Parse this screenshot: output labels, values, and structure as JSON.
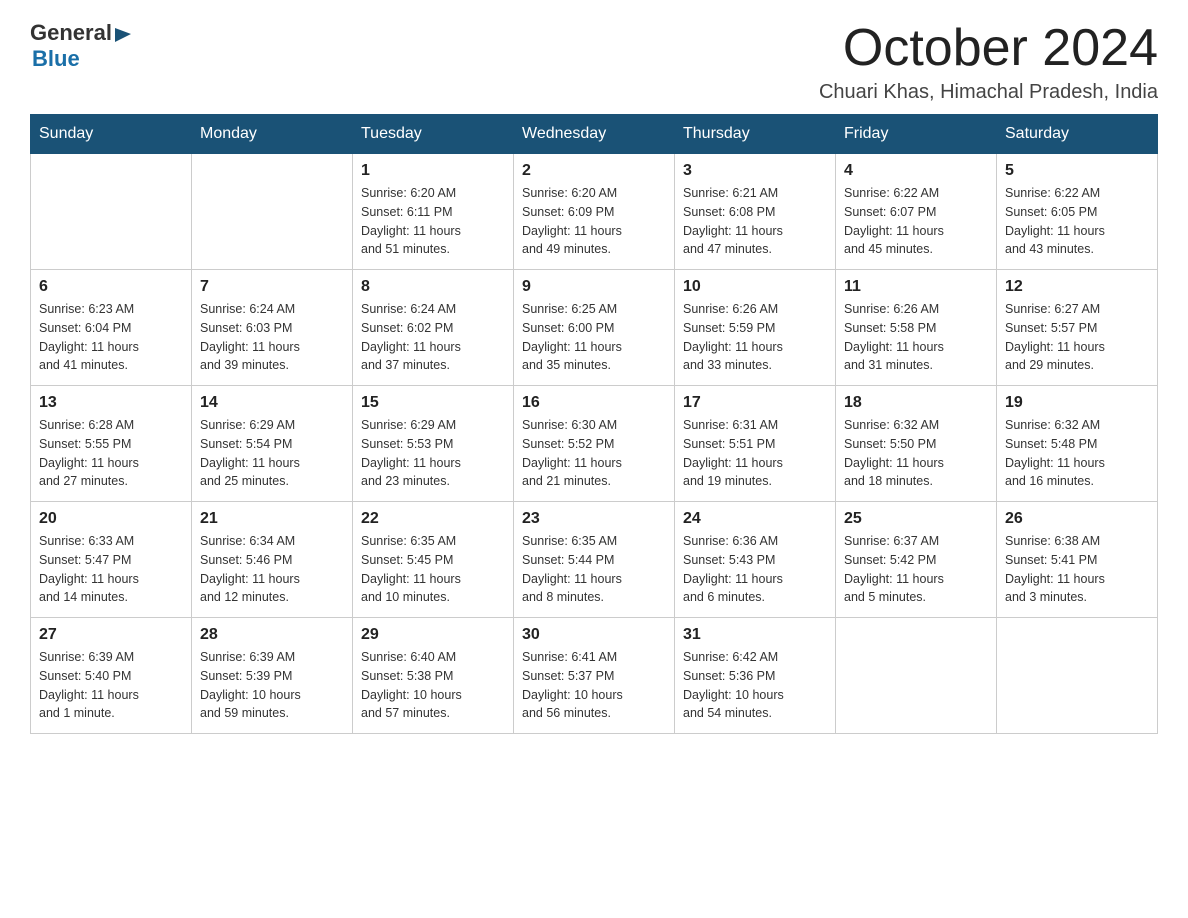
{
  "logo": {
    "general": "General",
    "blue": "Blue"
  },
  "title": "October 2024",
  "location": "Chuari Khas, Himachal Pradesh, India",
  "weekdays": [
    "Sunday",
    "Monday",
    "Tuesday",
    "Wednesday",
    "Thursday",
    "Friday",
    "Saturday"
  ],
  "weeks": [
    [
      {
        "day": "",
        "info": ""
      },
      {
        "day": "",
        "info": ""
      },
      {
        "day": "1",
        "info": "Sunrise: 6:20 AM\nSunset: 6:11 PM\nDaylight: 11 hours\nand 51 minutes."
      },
      {
        "day": "2",
        "info": "Sunrise: 6:20 AM\nSunset: 6:09 PM\nDaylight: 11 hours\nand 49 minutes."
      },
      {
        "day": "3",
        "info": "Sunrise: 6:21 AM\nSunset: 6:08 PM\nDaylight: 11 hours\nand 47 minutes."
      },
      {
        "day": "4",
        "info": "Sunrise: 6:22 AM\nSunset: 6:07 PM\nDaylight: 11 hours\nand 45 minutes."
      },
      {
        "day": "5",
        "info": "Sunrise: 6:22 AM\nSunset: 6:05 PM\nDaylight: 11 hours\nand 43 minutes."
      }
    ],
    [
      {
        "day": "6",
        "info": "Sunrise: 6:23 AM\nSunset: 6:04 PM\nDaylight: 11 hours\nand 41 minutes."
      },
      {
        "day": "7",
        "info": "Sunrise: 6:24 AM\nSunset: 6:03 PM\nDaylight: 11 hours\nand 39 minutes."
      },
      {
        "day": "8",
        "info": "Sunrise: 6:24 AM\nSunset: 6:02 PM\nDaylight: 11 hours\nand 37 minutes."
      },
      {
        "day": "9",
        "info": "Sunrise: 6:25 AM\nSunset: 6:00 PM\nDaylight: 11 hours\nand 35 minutes."
      },
      {
        "day": "10",
        "info": "Sunrise: 6:26 AM\nSunset: 5:59 PM\nDaylight: 11 hours\nand 33 minutes."
      },
      {
        "day": "11",
        "info": "Sunrise: 6:26 AM\nSunset: 5:58 PM\nDaylight: 11 hours\nand 31 minutes."
      },
      {
        "day": "12",
        "info": "Sunrise: 6:27 AM\nSunset: 5:57 PM\nDaylight: 11 hours\nand 29 minutes."
      }
    ],
    [
      {
        "day": "13",
        "info": "Sunrise: 6:28 AM\nSunset: 5:55 PM\nDaylight: 11 hours\nand 27 minutes."
      },
      {
        "day": "14",
        "info": "Sunrise: 6:29 AM\nSunset: 5:54 PM\nDaylight: 11 hours\nand 25 minutes."
      },
      {
        "day": "15",
        "info": "Sunrise: 6:29 AM\nSunset: 5:53 PM\nDaylight: 11 hours\nand 23 minutes."
      },
      {
        "day": "16",
        "info": "Sunrise: 6:30 AM\nSunset: 5:52 PM\nDaylight: 11 hours\nand 21 minutes."
      },
      {
        "day": "17",
        "info": "Sunrise: 6:31 AM\nSunset: 5:51 PM\nDaylight: 11 hours\nand 19 minutes."
      },
      {
        "day": "18",
        "info": "Sunrise: 6:32 AM\nSunset: 5:50 PM\nDaylight: 11 hours\nand 18 minutes."
      },
      {
        "day": "19",
        "info": "Sunrise: 6:32 AM\nSunset: 5:48 PM\nDaylight: 11 hours\nand 16 minutes."
      }
    ],
    [
      {
        "day": "20",
        "info": "Sunrise: 6:33 AM\nSunset: 5:47 PM\nDaylight: 11 hours\nand 14 minutes."
      },
      {
        "day": "21",
        "info": "Sunrise: 6:34 AM\nSunset: 5:46 PM\nDaylight: 11 hours\nand 12 minutes."
      },
      {
        "day": "22",
        "info": "Sunrise: 6:35 AM\nSunset: 5:45 PM\nDaylight: 11 hours\nand 10 minutes."
      },
      {
        "day": "23",
        "info": "Sunrise: 6:35 AM\nSunset: 5:44 PM\nDaylight: 11 hours\nand 8 minutes."
      },
      {
        "day": "24",
        "info": "Sunrise: 6:36 AM\nSunset: 5:43 PM\nDaylight: 11 hours\nand 6 minutes."
      },
      {
        "day": "25",
        "info": "Sunrise: 6:37 AM\nSunset: 5:42 PM\nDaylight: 11 hours\nand 5 minutes."
      },
      {
        "day": "26",
        "info": "Sunrise: 6:38 AM\nSunset: 5:41 PM\nDaylight: 11 hours\nand 3 minutes."
      }
    ],
    [
      {
        "day": "27",
        "info": "Sunrise: 6:39 AM\nSunset: 5:40 PM\nDaylight: 11 hours\nand 1 minute."
      },
      {
        "day": "28",
        "info": "Sunrise: 6:39 AM\nSunset: 5:39 PM\nDaylight: 10 hours\nand 59 minutes."
      },
      {
        "day": "29",
        "info": "Sunrise: 6:40 AM\nSunset: 5:38 PM\nDaylight: 10 hours\nand 57 minutes."
      },
      {
        "day": "30",
        "info": "Sunrise: 6:41 AM\nSunset: 5:37 PM\nDaylight: 10 hours\nand 56 minutes."
      },
      {
        "day": "31",
        "info": "Sunrise: 6:42 AM\nSunset: 5:36 PM\nDaylight: 10 hours\nand 54 minutes."
      },
      {
        "day": "",
        "info": ""
      },
      {
        "day": "",
        "info": ""
      }
    ]
  ]
}
